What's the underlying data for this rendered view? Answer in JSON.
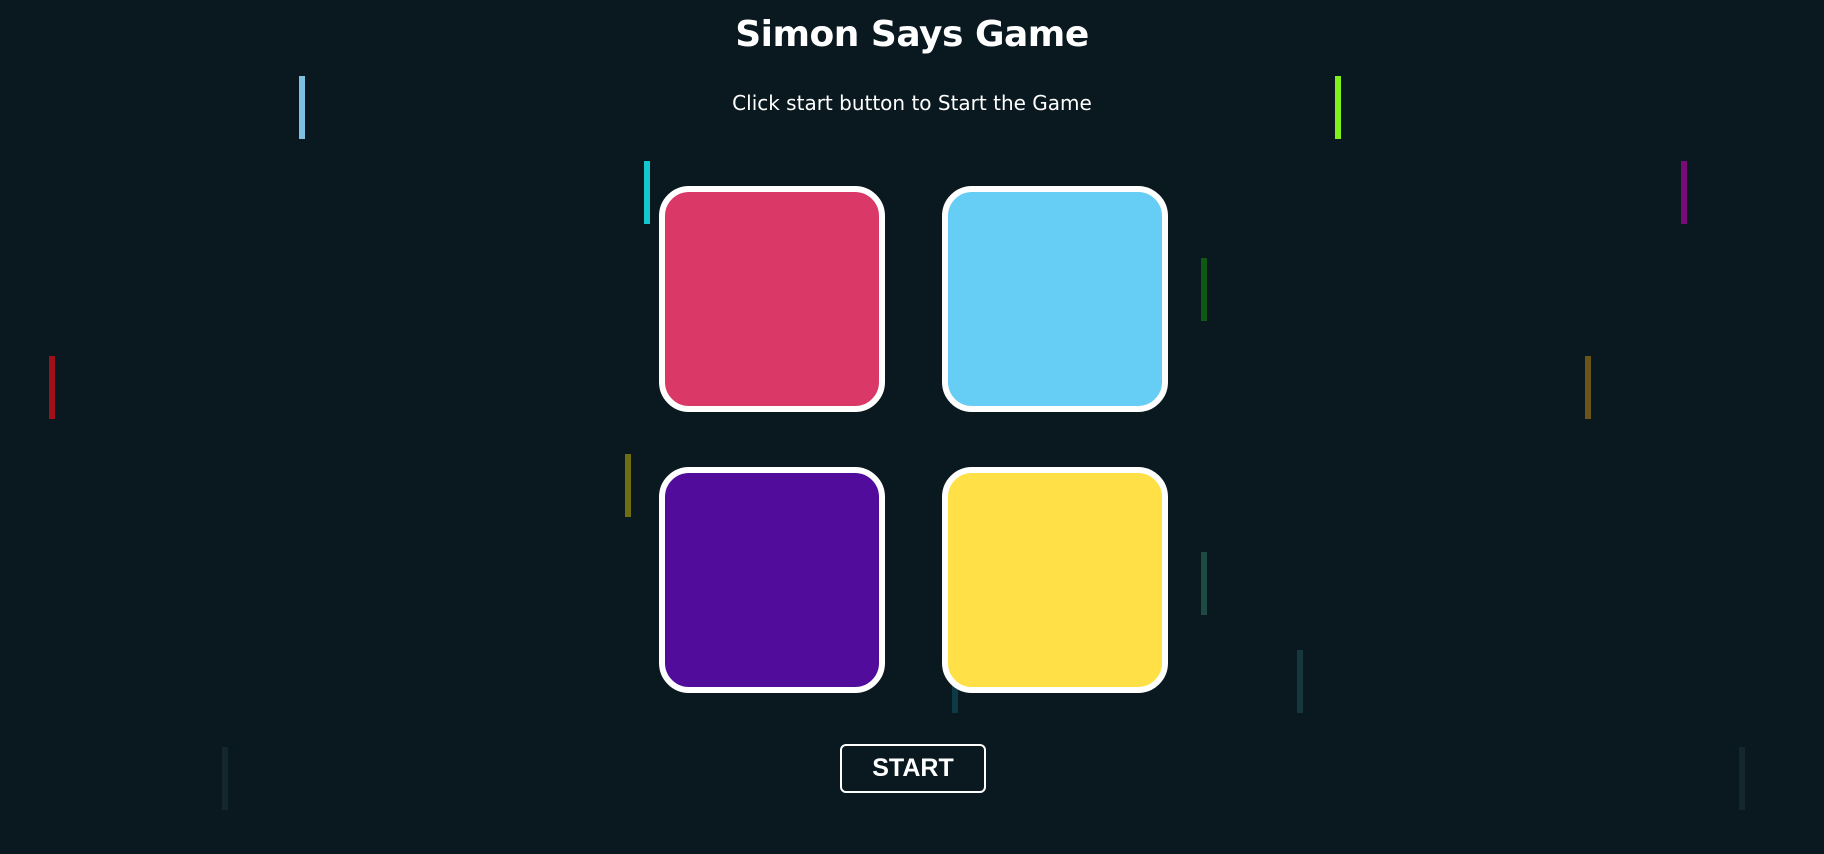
{
  "game": {
    "title": "Simon Says Game",
    "status": "Click start button to Start the Game",
    "start_label": "START"
  },
  "colors": {
    "background": "#0a1920",
    "pad_border": "#ffffff",
    "red": "#da3968",
    "blue": "#66cdf5",
    "purple": "#520c9c",
    "yellow": "#ffe147"
  },
  "pads": [
    {
      "id": "red",
      "color": "#da3968"
    },
    {
      "id": "blue",
      "color": "#66cdf5"
    },
    {
      "id": "purple",
      "color": "#520c9c"
    },
    {
      "id": "yellow",
      "color": "#ffe147"
    }
  ],
  "decorations": {
    "streak_colors": [
      "#7ec0e0",
      "#7ff01a",
      "#14c6d0",
      "#7a0a78",
      "#0e5a14",
      "#a0101a",
      "#6a5418",
      "#6e6e10",
      "#1f4a44",
      "#0e3a48",
      "#15373e",
      "#14262e",
      "#14262e"
    ]
  }
}
